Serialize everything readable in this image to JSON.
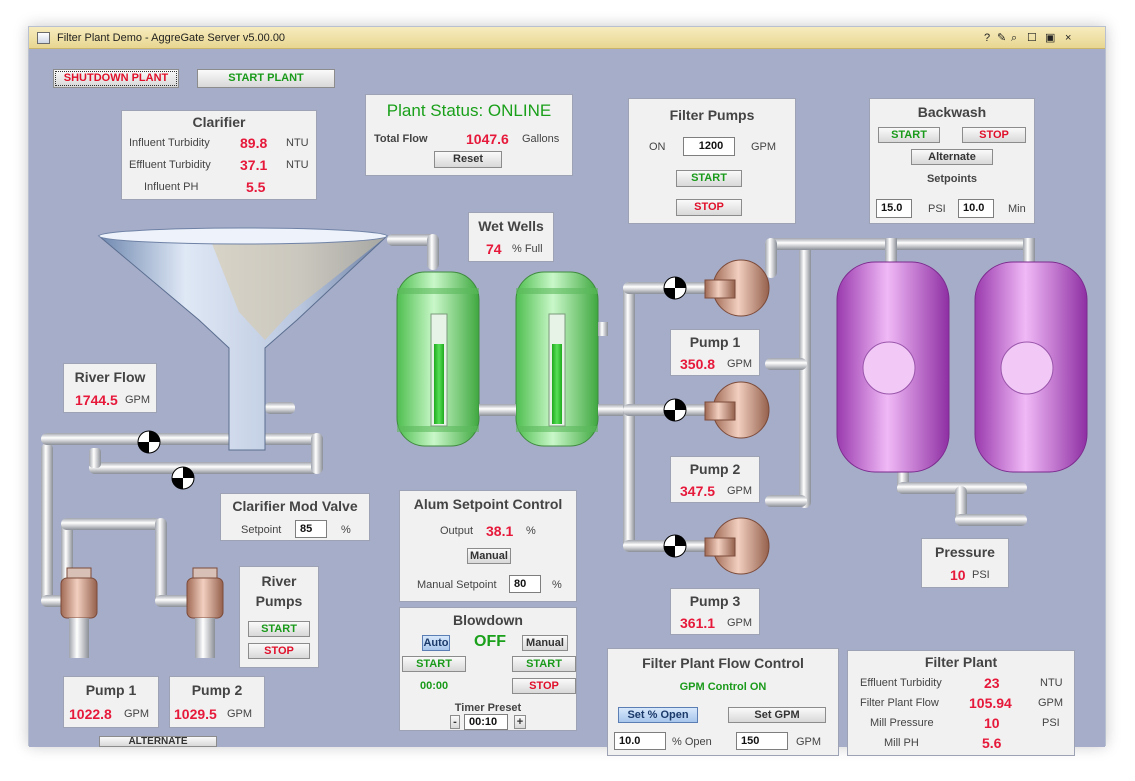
{
  "window": {
    "title": "Filter Plant Demo - AggreGate Server v5.00.00",
    "controls": [
      "?",
      "✎",
      "⌕",
      "☐",
      "▣",
      "×"
    ]
  },
  "top_buttons": {
    "shutdown": "SHUTDOWN PLANT",
    "start": "START PLANT"
  },
  "clarifier": {
    "title": "Clarifier",
    "rows": [
      {
        "label": "Influent Turbidity",
        "value": "89.8",
        "unit": "NTU"
      },
      {
        "label": "Effluent Turbidity",
        "value": "37.1",
        "unit": "NTU"
      },
      {
        "label": "Influent PH",
        "value": "5.5",
        "unit": ""
      }
    ]
  },
  "plant_status": {
    "title": "Plant Status: ONLINE",
    "total_flow_label": "Total Flow",
    "total_flow": "1047.6",
    "total_flow_unit": "Gallons",
    "reset": "Reset"
  },
  "filter_pumps": {
    "title": "Filter Pumps",
    "on_label": "ON",
    "gpm_value": "1200",
    "gpm_unit": "GPM",
    "start": "START",
    "stop": "STOP"
  },
  "backwash": {
    "title": "Backwash",
    "start": "START",
    "stop": "STOP",
    "alternate": "Alternate",
    "setpoints_label": "Setpoints",
    "psi_value": "15.0",
    "psi_unit": "PSI",
    "min_value": "10.0",
    "min_unit": "Min"
  },
  "wet_wells": {
    "title": "Wet Wells",
    "value": "74",
    "unit": "% Full",
    "level_fraction": 0.74
  },
  "river_flow": {
    "title": "River Flow",
    "value": "1744.5",
    "unit": "GPM"
  },
  "right_pumps": [
    {
      "title": "Pump 1",
      "value": "350.8",
      "unit": "GPM"
    },
    {
      "title": "Pump 2",
      "value": "347.5",
      "unit": "GPM"
    },
    {
      "title": "Pump 3",
      "value": "361.1",
      "unit": "GPM"
    }
  ],
  "clarifier_mod_valve": {
    "title": "Clarifier Mod Valve",
    "setpoint_label": "Setpoint",
    "value": "85",
    "unit": "%"
  },
  "alum": {
    "title": "Alum Setpoint Control",
    "output_label": "Output",
    "output_value": "38.1",
    "output_unit": "%",
    "manual": "Manual",
    "manual_setpoint_label": "Manual Setpoint",
    "manual_setpoint_value": "80",
    "manual_setpoint_unit": "%"
  },
  "river_pumps": {
    "title_line1": "River",
    "title_line2": "Pumps",
    "start": "START",
    "stop": "STOP"
  },
  "left_pumps": [
    {
      "title": "Pump 1",
      "value": "1022.8",
      "unit": "GPM"
    },
    {
      "title": "Pump 2",
      "value": "1029.5",
      "unit": "GPM"
    }
  ],
  "alternate_button": "ALTERNATE",
  "blowdown": {
    "title": "Blowdown",
    "auto": "Auto",
    "state": "OFF",
    "manual": "Manual",
    "start_left": "START",
    "start_right": "START",
    "timer_value": "00:00",
    "stop": "STOP",
    "timer_preset_label": "Timer Preset",
    "minus": "-",
    "preset_value": "00:10",
    "plus": "+"
  },
  "pressure": {
    "title": "Pressure",
    "value": "10",
    "unit": "PSI"
  },
  "flow_control": {
    "title": "Filter Plant Flow Control",
    "status": "GPM Control ON",
    "set_open": "Set % Open",
    "set_gpm": "Set GPM",
    "open_value": "10.0",
    "open_unit": "% Open",
    "gpm_value": "150",
    "gpm_unit": "GPM"
  },
  "filter_plant": {
    "title": "Filter Plant",
    "rows": [
      {
        "label": "Effluent Turbidity",
        "value": "23",
        "unit": "NTU"
      },
      {
        "label": "Filter Plant Flow",
        "value": "105.94",
        "unit": "GPM"
      },
      {
        "label": "Mill Pressure",
        "value": "10",
        "unit": "PSI"
      },
      {
        "label": "Mill PH",
        "value": "5.6",
        "unit": ""
      }
    ]
  },
  "colors": {
    "value_red": "#e6193b",
    "start_green": "#1a9a1a",
    "status_green": "#1aa01a",
    "background": "#a6adc8",
    "well_green": "#7fe07f",
    "tank_purple": "#c25ad6"
  }
}
